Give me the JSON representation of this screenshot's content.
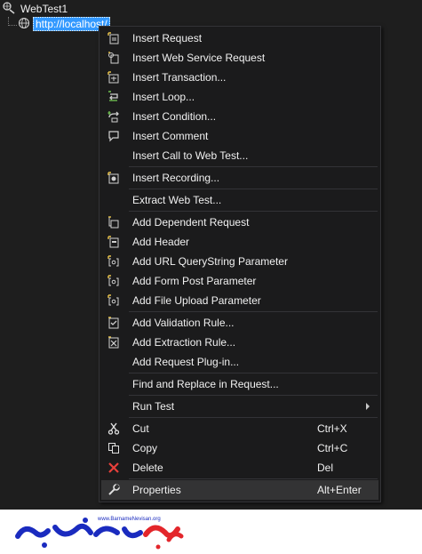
{
  "tree": {
    "root_label": "WebTest1",
    "child_label": "http://localhost/"
  },
  "menu": {
    "items": [
      {
        "label": "Insert Request",
        "icon": "insert-request-icon"
      },
      {
        "label": "Insert Web Service Request",
        "icon": "web-service-icon"
      },
      {
        "label": "Insert Transaction...",
        "icon": "transaction-icon"
      },
      {
        "label": "Insert Loop...",
        "icon": "loop-icon"
      },
      {
        "label": "Insert Condition...",
        "icon": "condition-icon"
      },
      {
        "label": "Insert Comment",
        "icon": "comment-icon"
      },
      {
        "label": "Insert Call to Web Test...",
        "icon": ""
      },
      {
        "label": "Insert Recording...",
        "icon": "recording-icon"
      },
      {
        "label": "Extract Web Test...",
        "icon": ""
      },
      {
        "label": "Add Dependent Request",
        "icon": "dependent-request-icon"
      },
      {
        "label": "Add Header",
        "icon": "header-icon"
      },
      {
        "label": "Add URL QueryString Parameter",
        "icon": "parameter-icon"
      },
      {
        "label": "Add Form Post Parameter",
        "icon": "parameter-icon"
      },
      {
        "label": "Add File Upload Parameter",
        "icon": "parameter-icon"
      },
      {
        "label": "Add Validation Rule...",
        "icon": "validation-rule-icon"
      },
      {
        "label": "Add Extraction Rule...",
        "icon": "extraction-rule-icon"
      },
      {
        "label": "Add Request Plug-in...",
        "icon": ""
      },
      {
        "label": "Find and Replace in Request...",
        "icon": ""
      },
      {
        "label": "Run Test",
        "icon": ""
      },
      {
        "label": "Cut",
        "shortcut": "Ctrl+X",
        "icon": "scissors-icon"
      },
      {
        "label": "Copy",
        "shortcut": "Ctrl+C",
        "icon": "copy-icon"
      },
      {
        "label": "Delete",
        "shortcut": "Del",
        "icon": "delete-icon"
      },
      {
        "label": "Properties",
        "shortcut": "Alt+Enter",
        "icon": "wrench-icon"
      }
    ]
  },
  "watermark": {
    "url": "www.BarnameNevisan.org"
  },
  "colors": {
    "background": "#1e1e1e",
    "menu_bg": "#1b1b1c",
    "selection": "#3399ff",
    "highlight": "#333334",
    "logo_blue": "#1a2bbf",
    "logo_red": "#e3262b"
  }
}
